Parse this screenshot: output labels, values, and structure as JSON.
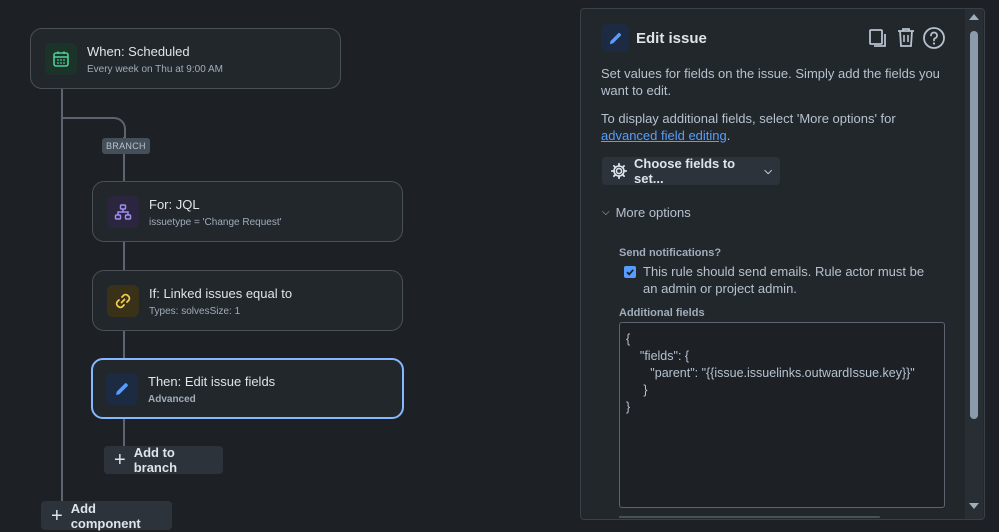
{
  "canvas": {
    "trigger": {
      "title": "When: Scheduled",
      "subtitle": "Every week on Thu at 9:00 AM"
    },
    "branch_label": "BRANCH",
    "branch_items": [
      {
        "title": "For: JQL",
        "subtitle": "issuetype = 'Change Request'",
        "icon": "hierarchy-icon"
      },
      {
        "title": "If: Linked issues equal to",
        "subtitle": "Types: solvesSize: 1",
        "icon": "link-icon"
      },
      {
        "title": "Then: Edit issue fields",
        "subtitle": "Advanced",
        "icon": "pencil-icon"
      }
    ],
    "add_to_branch": "Add to branch",
    "add_component": "Add component"
  },
  "panel": {
    "title": "Edit issue",
    "description": "Set values for fields on the issue. Simply add the fields you want to edit.",
    "more_text_before": "To display additional fields, select 'More options' for ",
    "more_text_link": "advanced field editing",
    "more_text_after": ".",
    "choose_fields_label": "Choose fields to set...",
    "more_options_label": "More options",
    "send_notifications_label": "Send notifications?",
    "send_notifications_checked": true,
    "send_notifications_text": "This rule should send emails. Rule actor must be an admin or project admin.",
    "additional_fields_label": "Additional fields",
    "additional_fields_lines": [
      "{",
      "    \"fields\": {",
      "       \"parent\": \"{{issue.issuelinks.outwardIssue.key}}\"",
      "     }",
      "}"
    ]
  },
  "colors": {
    "accent": "#579dff",
    "selected_border": "#85b8ff",
    "background": "#1d2125"
  }
}
